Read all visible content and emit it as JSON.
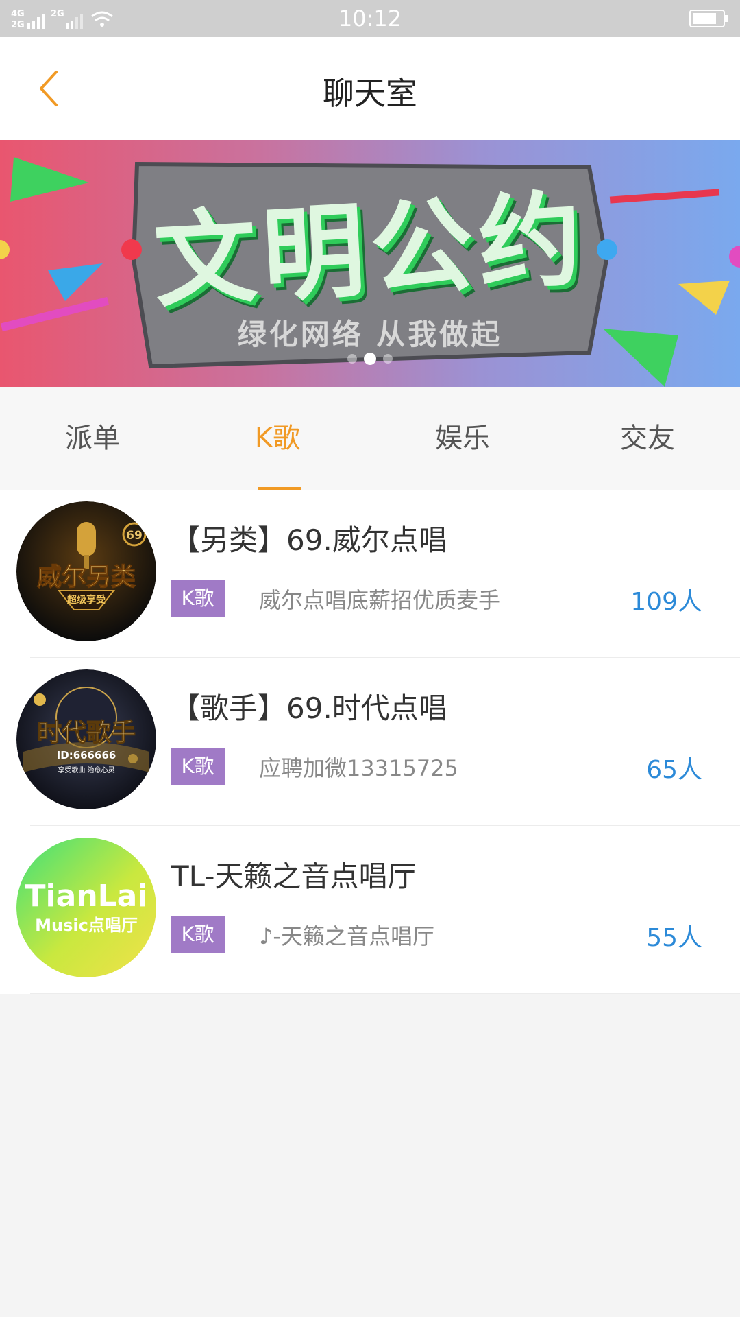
{
  "status_bar": {
    "time": "10:12",
    "network": "4G 2G"
  },
  "header": {
    "title": "聊天室"
  },
  "banner": {
    "title": "文明公约",
    "subtitle": "绿化网络 从我做起",
    "slide_count": 3,
    "active_slide": 2
  },
  "tabs": [
    {
      "label": "派单"
    },
    {
      "label": "K歌"
    },
    {
      "label": "娱乐"
    },
    {
      "label": "交友"
    }
  ],
  "active_tab": 1,
  "rooms": [
    {
      "name": "【另类】69.威尔点唱",
      "tag": "K歌",
      "description": "威尔点唱底薪招优质麦手",
      "count": "109人",
      "avatar": {
        "line1": "威尔另类",
        "line2": "超级享受",
        "badge": "69"
      }
    },
    {
      "name": "【歌手】69.时代点唱",
      "tag": "K歌",
      "description": "应聘加微13315725",
      "count": "65人",
      "avatar": {
        "line1": "时代歌手",
        "line2": "ID:666666",
        "line3": "享受歌曲  治愈心灵"
      }
    },
    {
      "name": "TL-天籁之音点唱厅",
      "tag": "K歌",
      "description": "♪-天籁之音点唱厅",
      "count": "55人",
      "avatar": {
        "line1": "TianLai",
        "line2": "Music点唱厅"
      }
    }
  ],
  "colors": {
    "accent": "#f19a25",
    "tag": "#a07ac6",
    "count": "#2c8ad8"
  }
}
